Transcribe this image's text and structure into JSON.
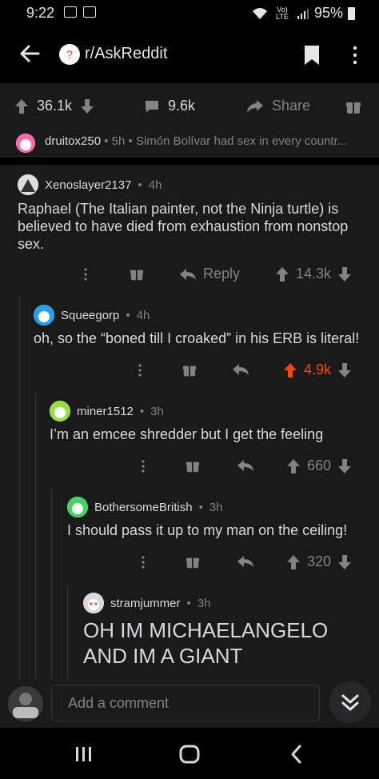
{
  "status_bar": {
    "time": "9:22",
    "network": "Vo) LTE",
    "battery": "95%"
  },
  "header": {
    "subreddit": "r/AskReddit"
  },
  "post_bar": {
    "upvotes": "36.1k",
    "comments": "9.6k",
    "share_label": "Share"
  },
  "parent_context": {
    "username": "druitox250",
    "age": "5h",
    "snippet": "Simón Bolívar had sex in every countr..."
  },
  "comments": [
    {
      "username": "Xenoslayer2137",
      "age": "4h",
      "text": "Raphael (The Italian painter, not the Ninja turtle) is believed to have died from exhaustion from nonstop sex.",
      "reply_label": "Reply",
      "score": "14.3k"
    },
    {
      "username": "Squeegorp",
      "age": "4h",
      "text": "oh, so the “boned till I croaked” in his ERB is literal!",
      "score": "4.9k",
      "score_color": "#ff4500"
    },
    {
      "username": "miner1512",
      "age": "3h",
      "text": "I’m an emcee shredder but I get the feeling",
      "score": "660"
    },
    {
      "username": "BothersomeBritish",
      "age": "3h",
      "text": "I should pass it up to my man on the ceiling!",
      "score": "320"
    },
    {
      "username": "stramjummer",
      "age": "3h",
      "text": "OH IM MICHAELANGELO AND IM A GIANT"
    }
  ],
  "add_comment": {
    "placeholder": "Add a comment"
  },
  "colors": {
    "background": "#1a1a1b",
    "text": "#d7dadc",
    "muted": "#818384",
    "upvoted": "#ff4500"
  }
}
